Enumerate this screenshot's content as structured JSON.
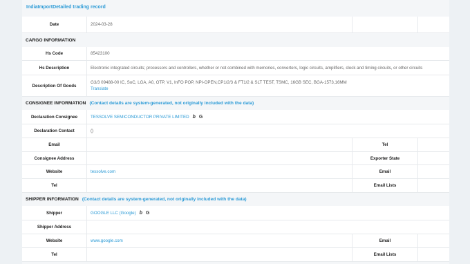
{
  "title": "IndiaImportDetailed trading record",
  "date_row": {
    "label": "Date",
    "value": "2024-03-28"
  },
  "cargo": {
    "heading": "CARGO INFORMATION",
    "hs_code_label": "Hs Code",
    "hs_code": "85423100",
    "hs_desc_label": "Hs Description",
    "hs_desc": "Electronic integrated circuits; processors and controllers, whether or not combined with memories, converters, logic circuits, amplifiers, clock and timing circuits, or other circuits",
    "goods_label": "Description Of Goods",
    "goods": "G3/3 09488-00 IC, SoC, LGA, A0, OTP, V1, InFO POP, NPI-OPEN,CP1/2/3 & FT1/2 & SLT TEST, TSMC, 16GB SEC, BGA-1573,16MM",
    "translate": "Translate"
  },
  "consignee": {
    "heading": "CONSIGNEE INFORMATION",
    "note": "(Contact details are system-generated, not originally included with the data)",
    "declaration_consignee_label": "Declaration Consignee",
    "declaration_consignee": "TESSOLVE SEMICONDUCTOR PRIVATE LIMITED",
    "declaration_contact_label": "Declaration Contact",
    "declaration_contact": "()",
    "email_label": "Email",
    "tel_right_label": "Tel",
    "address_label": "Consignee Address",
    "exporter_state_label": "Exporter State",
    "website_label": "Website",
    "website": "tessolve.com",
    "email_right_label": "Email",
    "tel_label": "Tel",
    "email_lists_label": "Email Lists"
  },
  "shipper": {
    "heading": "SHIPPER INFORMATION",
    "note": "(Contact details are system-generated, not originally included with the data)",
    "shipper_label": "Shipper",
    "shipper": "GOOGLE LLC (Google)",
    "address_label": "Shipper Address",
    "website_label": "Website",
    "website": "www.google.com",
    "email_right_label": "Email",
    "tel_label": "Tel",
    "email_lists_label": "Email Lists"
  },
  "icons": {
    "bing": "bing-icon",
    "google": "google-icon",
    "bing_glyph": "b",
    "google_glyph": "G"
  }
}
